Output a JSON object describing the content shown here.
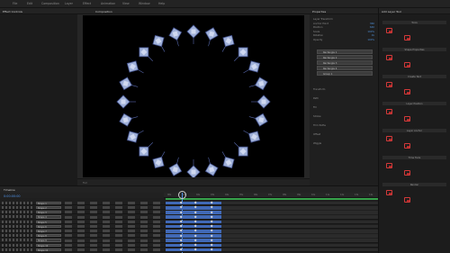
{
  "app": {
    "menu": [
      "File",
      "Edit",
      "Composition",
      "Layer",
      "Effect",
      "Animation",
      "View",
      "Window",
      "Help"
    ],
    "panel_tabs": {
      "project_tab": "Effect Controls",
      "comp_tab": "Composition",
      "props_title": "Properties",
      "right_title": "Add Layer Tool"
    }
  },
  "viewer": {
    "zoom_label": "Full",
    "ring_count": 24,
    "shape_color": "#9fb0d8",
    "background": "#000000"
  },
  "properties": {
    "rows": [
      "Layer Transform",
      "Anchor Point",
      "Position",
      "Scale",
      "Rotation",
      "Opacity"
    ],
    "values": [
      "",
      "360",
      "640",
      "100%",
      "0x",
      "100%"
    ],
    "layers": [
      "Rectangle 1",
      "Rectangle 2",
      "Rectangle 3",
      "Rectangle 4",
      "Group 1"
    ],
    "other": [
      "Transform",
      "Path",
      "Fill",
      "Stroke",
      "Trim Paths",
      "Offset",
      "Wiggle"
    ]
  },
  "right_panel": {
    "sections": [
      "Tools",
      "Shape Properties",
      "Create Text",
      "Layer Position",
      "Layer Anchor",
      "Time Tools",
      "Render"
    ]
  },
  "timeline": {
    "tab": "Timeline",
    "timecode": "0:00:00:00",
    "ruler_ticks": [
      "00s",
      "01s",
      "02s",
      "03s",
      "04s",
      "05s",
      "06s",
      "07s",
      "08s",
      "09s",
      "10s",
      "11s",
      "12s",
      "13s",
      "14s"
    ],
    "layers": [
      "Shape 1",
      "Shape 2",
      "Shape 3",
      "Shape 4",
      "Shape 5",
      "Shape 6",
      "Shape 7",
      "Shape 8",
      "Shape 9",
      "Shape 10",
      "Shape 11"
    ],
    "accent": "#4f93e8",
    "bar_color": "#4169b6"
  }
}
